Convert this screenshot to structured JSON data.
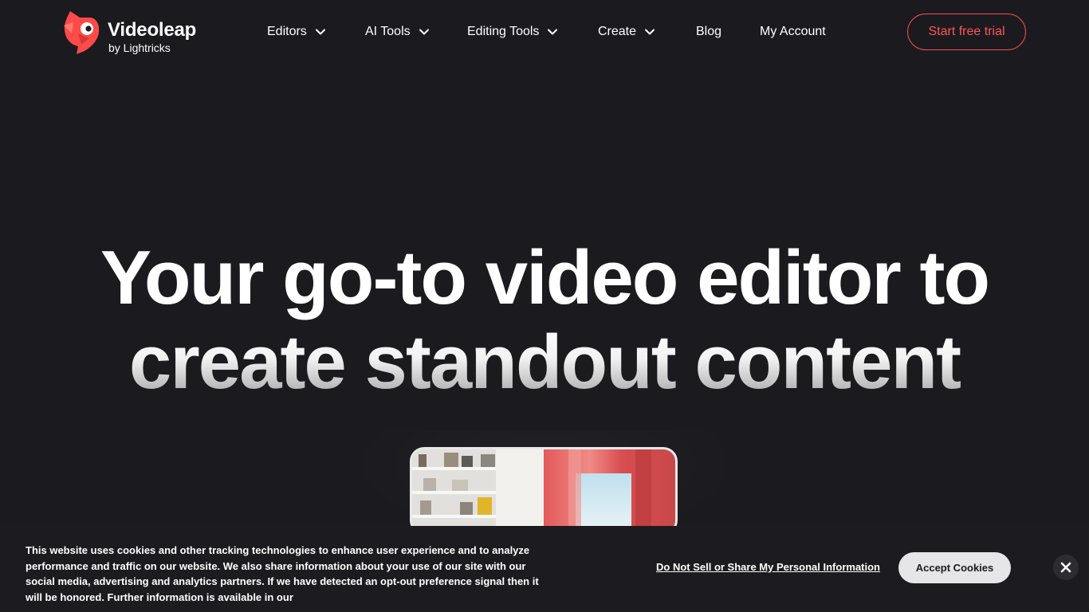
{
  "brand": {
    "name": "Videoleap",
    "sub": "by Lightricks",
    "accent": "#ff4d4d",
    "logo_icon": "bird-logo-icon"
  },
  "nav": {
    "items": [
      {
        "label": "Editors",
        "has_dropdown": true
      },
      {
        "label": "AI Tools",
        "has_dropdown": true
      },
      {
        "label": "Editing Tools",
        "has_dropdown": true
      },
      {
        "label": "Create",
        "has_dropdown": true
      },
      {
        "label": "Blog",
        "has_dropdown": false
      },
      {
        "label": "My Account",
        "has_dropdown": false
      }
    ],
    "dropdown_icon": "chevron-down-icon",
    "cta_label": "Start free trial"
  },
  "hero": {
    "line1": "Your go-to video editor to",
    "line2": "create standout content"
  },
  "cookie": {
    "text": "This website uses cookies and other tracking technologies to enhance user experience and to analyze performance and traffic on our website. We also share information about your use of our site with our social media, advertising and analytics partners. If we have detected an opt-out preference signal then it will be honored. Further information is available in our",
    "do_not_sell_label": "Do Not Sell or Share My Personal Information",
    "accept_label": "Accept Cookies",
    "close_icon": "close-icon"
  },
  "colors": {
    "background": "#1b1b1f",
    "cta_text": "#ff5656",
    "accept_bg": "#e6e6e8"
  }
}
